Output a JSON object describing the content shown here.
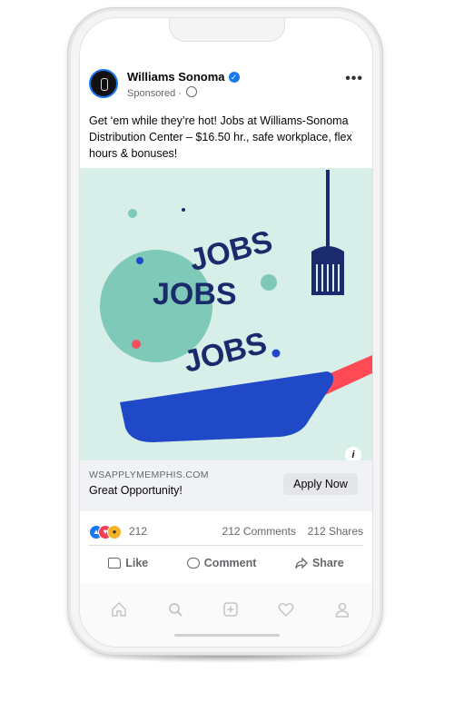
{
  "post": {
    "page_name": "Williams Sonoma",
    "sponsored_label": "Sponsored ·",
    "text": "Get ‘em while they’re hot! Jobs at Williams-Sonoma Distribution Center – $16.50 hr., safe workplace, flex hours & bonuses!"
  },
  "creative": {
    "words": [
      "JOBS",
      "JOBS",
      "JOBS"
    ],
    "colors": {
      "background": "#d8efe9",
      "circle": "#7fc9b8",
      "text": "#1a2a6c",
      "pan": "#1f49c6",
      "handle": "#ff4a55"
    }
  },
  "link": {
    "url": "WSAPPLYMEMPHIS.COM",
    "title": "Great Opportunity!",
    "cta_label": "Apply Now",
    "info_icon": "i"
  },
  "stats": {
    "reaction_count": "212",
    "comments": "212 Comments",
    "shares": "212 Shares",
    "reaction_icons": [
      "like-reaction-icon",
      "love-reaction-icon",
      "wow-reaction-icon"
    ]
  },
  "actions": {
    "like_label": "Like",
    "comment_label": "Comment",
    "share_label": "Share"
  },
  "nav": {
    "items": [
      "home-icon",
      "search-icon",
      "create-icon",
      "activity-icon",
      "profile-icon"
    ]
  }
}
